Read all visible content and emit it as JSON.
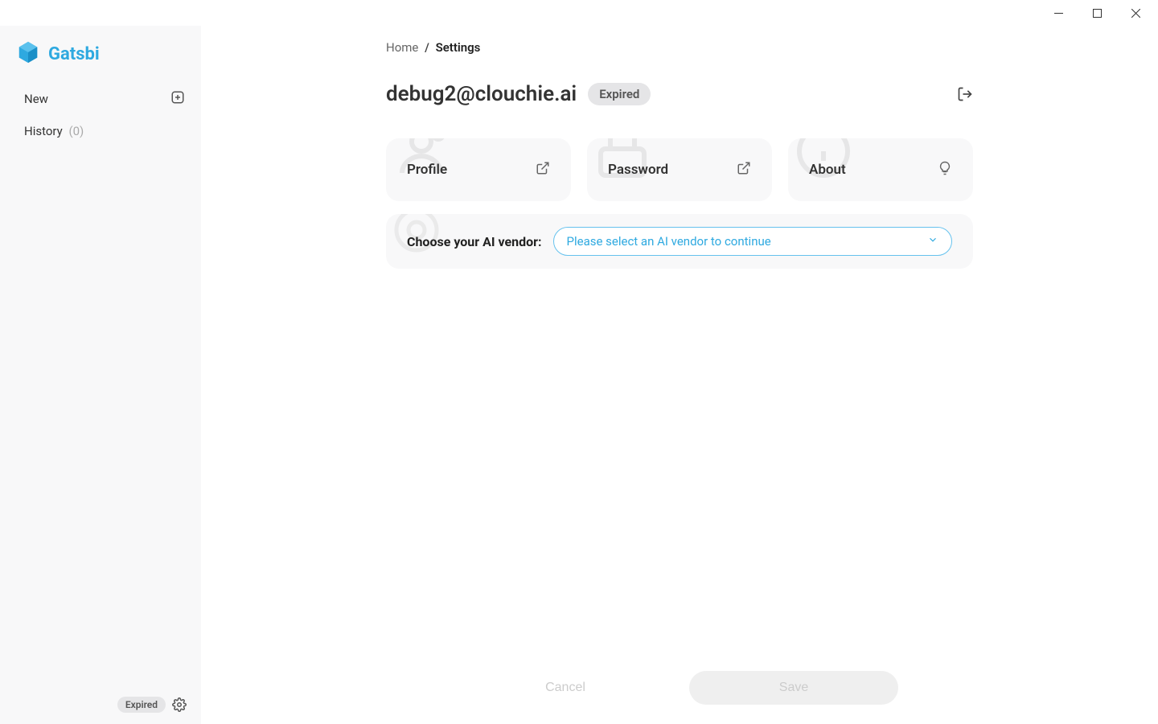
{
  "app": {
    "name": "Gatsbi"
  },
  "sidebar": {
    "new_label": "New",
    "history_label": "History",
    "history_count": "(0)",
    "footer_badge": "Expired"
  },
  "breadcrumb": {
    "home": "Home",
    "separator": "/",
    "current": "Settings"
  },
  "account": {
    "email": "debug2@clouchie.ai",
    "status": "Expired"
  },
  "cards": {
    "profile": "Profile",
    "password": "Password",
    "about": "About"
  },
  "vendor": {
    "label": "Choose your AI vendor:",
    "placeholder": "Please select an AI vendor to continue"
  },
  "actions": {
    "cancel": "Cancel",
    "save": "Save"
  }
}
